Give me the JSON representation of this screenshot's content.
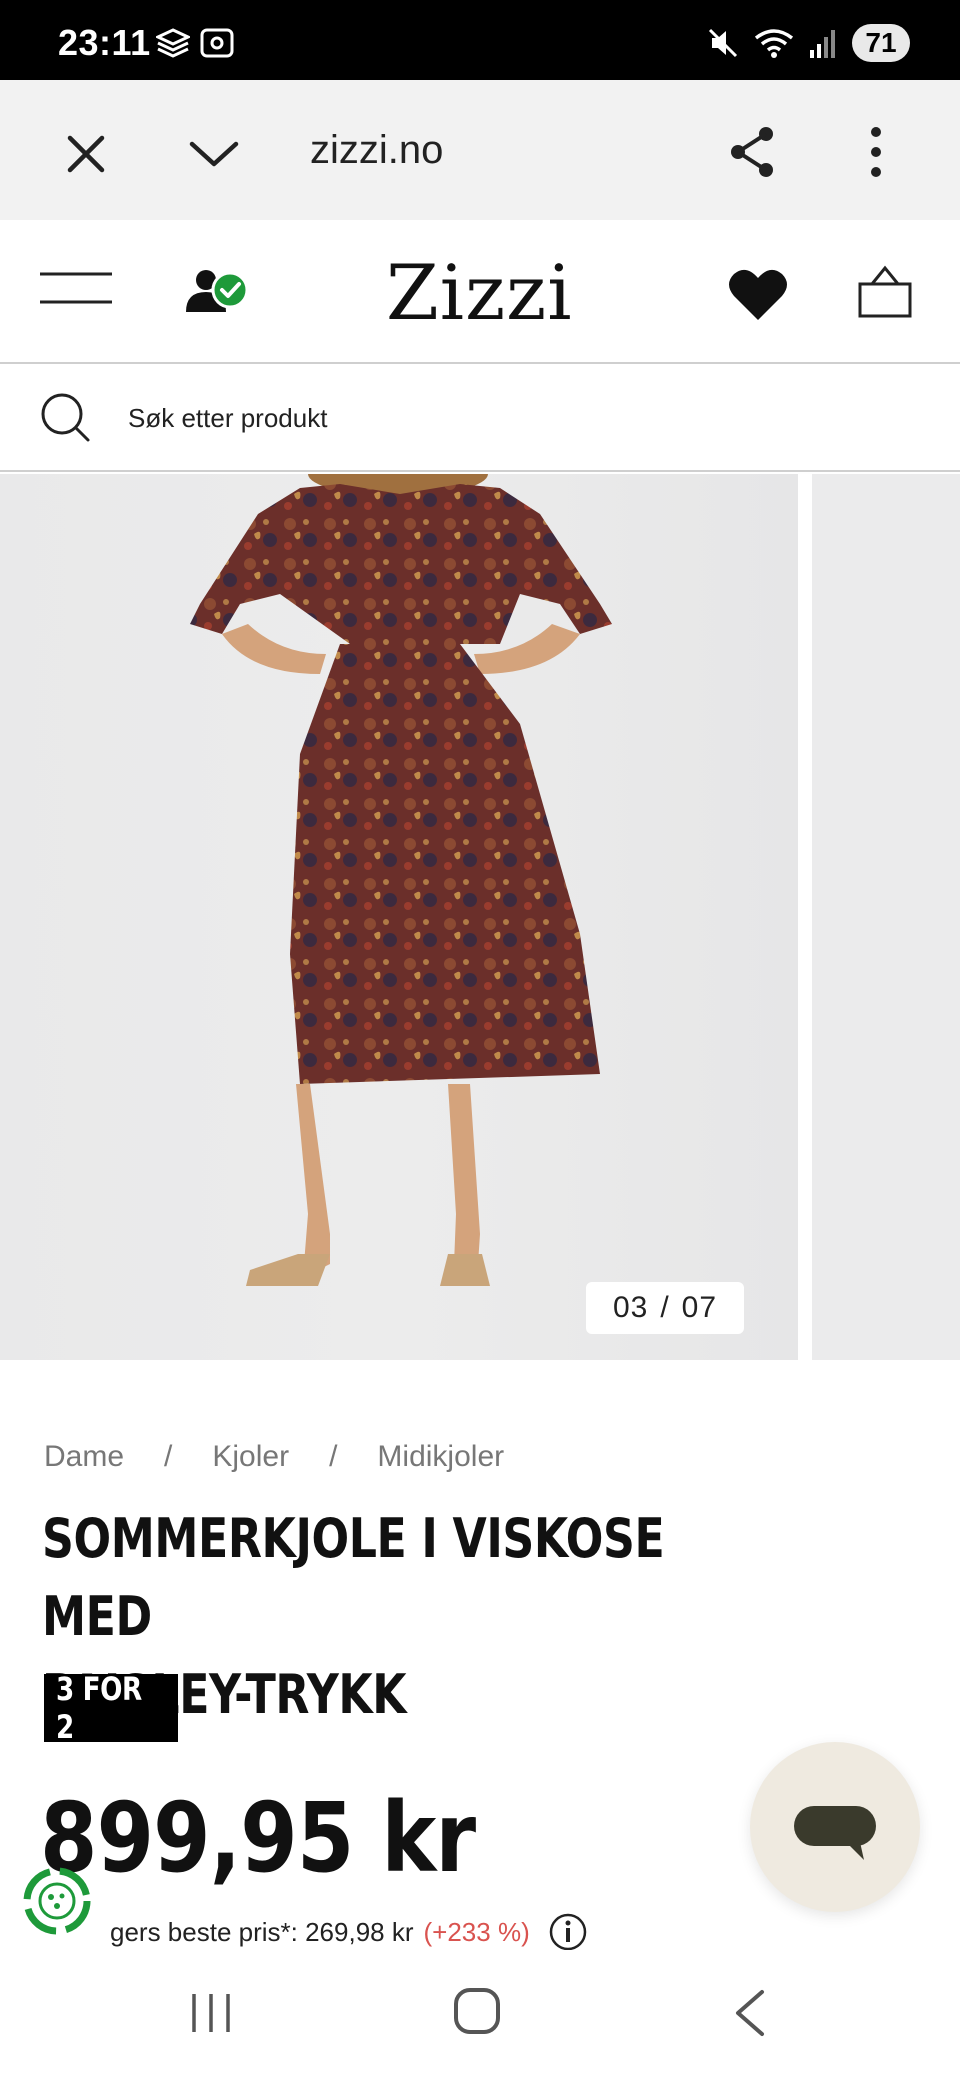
{
  "status_bar": {
    "time": "23:11",
    "battery": "71"
  },
  "browser": {
    "url": "zizzi.no"
  },
  "site": {
    "logo": "Zizzi"
  },
  "search": {
    "placeholder": "Søk etter produkt"
  },
  "gallery": {
    "current": "03",
    "separator": "/",
    "total": "07"
  },
  "breadcrumb": {
    "items": [
      "Dame",
      "Kjoler",
      "Midikjoler"
    ],
    "separator": "/"
  },
  "product": {
    "title_line1": "SOMMERKJOLE I VISKOSE MED",
    "title_line2": "PAISLEY-TRYKK",
    "promo": "3 FOR 2",
    "price": "899,95 kr",
    "lowest_price_text": "gers beste pris*: 269,98 kr",
    "lowest_price_change": "(+233 %)"
  },
  "colors": {
    "status_bar_bg": "#000000",
    "browser_bar_bg": "#f2f2f2",
    "accent_green": "#1e9a3a",
    "price_change_red": "#d9534f",
    "chat_bg": "#efeae0"
  },
  "icons": {
    "close": "close-icon",
    "chevron": "chevron-down-icon",
    "share": "share-icon",
    "more": "more-vert-icon",
    "menu": "hamburger-icon",
    "account": "account-verified-icon",
    "wishlist": "heart-icon",
    "cart": "basket-icon",
    "search": "search-icon",
    "info": "info-icon",
    "chat": "chat-icon"
  }
}
